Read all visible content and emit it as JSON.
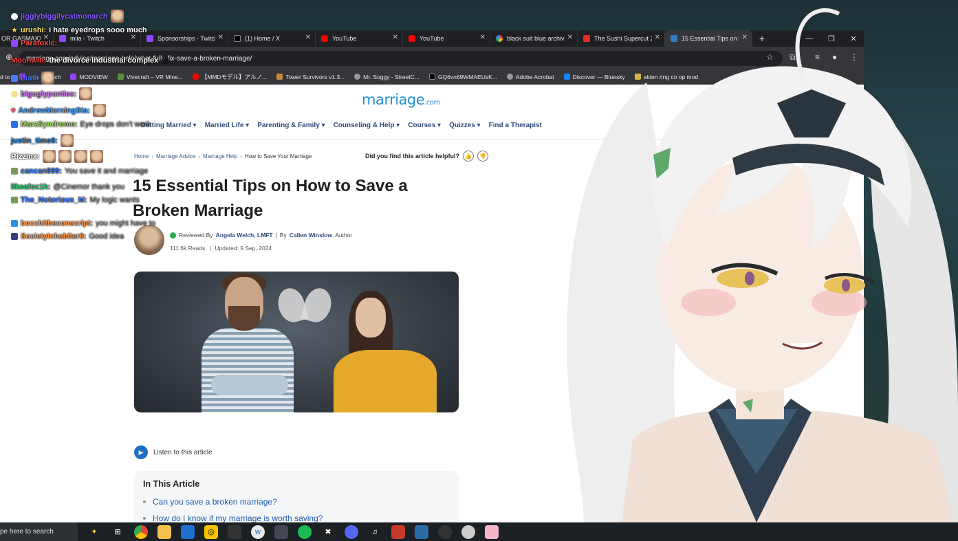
{
  "browser": {
    "tabs": [
      {
        "title": "OR GASMAXX",
        "icon": "twitch",
        "active": false
      },
      {
        "title": "miia - Twitch",
        "icon": "twitch",
        "active": false
      },
      {
        "title": "Sponsorships - Twitch",
        "icon": "twitch",
        "active": false
      },
      {
        "title": "(1) Home / X",
        "icon": "x",
        "active": false
      },
      {
        "title": "YouTube",
        "icon": "yt",
        "active": false
      },
      {
        "title": "YouTube",
        "icon": "yt",
        "active": false
      },
      {
        "title": "black suit blue archiv",
        "icon": "g",
        "active": false
      },
      {
        "title": "The Sushi Supercut 2",
        "icon": "sushi",
        "active": false
      },
      {
        "title": "15 Essential Tips on H",
        "icon": "mar",
        "active": true
      }
    ],
    "new_tab": "+",
    "address": "marriage.com/advice/marriage-help/what-fully-fix-save-a-broken-marriage/",
    "bookmarks": [
      {
        "label": "d to",
        "icon": "fav"
      },
      {
        "label": "miia - Twitch",
        "icon": "twitch"
      },
      {
        "label": "MODVIEW",
        "icon": "twitch"
      },
      {
        "label": "Vivecraft – VR Mine...",
        "icon": "fav"
      },
      {
        "label": "【MMDモデル】アルノ...",
        "icon": "yt"
      },
      {
        "label": "Tower Survivors v1.3...",
        "icon": "fav"
      },
      {
        "label": "Mr. Soggy - StreetC...",
        "icon": "fav"
      },
      {
        "label": "GQ6vn69WMAEUsK...",
        "icon": "x"
      },
      {
        "label": "Adobe Acrobat",
        "icon": "fav"
      },
      {
        "label": "Discover — Bluesky",
        "icon": "bsky"
      },
      {
        "label": "elden ring co op mod",
        "icon": "fav"
      }
    ]
  },
  "page": {
    "logo": "marriage",
    "logo_suffix": ".com",
    "nav": [
      "Getting Married ▾",
      "Married Life ▾",
      "Parenting & Family ▾",
      "Counseling & Help ▾",
      "Courses ▾",
      "Quizzes ▾",
      "Find a Therapist"
    ],
    "breadcrumbs": [
      "Home",
      "Marriage Advice",
      "Marriage Help",
      "How to Save Your Marriage"
    ],
    "breadcrumb_sep": "›",
    "helpful": "Did you find this article helpful?",
    "title": "15 Essential Tips on How to Save a Broken Marriage",
    "reviewed_by_label": "Reviewed By",
    "reviewer": "Angela Welch, LMFT",
    "by_label": "By",
    "author": "Callen Winslow",
    "author_role": ", Author",
    "reads": "111.6k Reads",
    "updated": "Updated: 9 Sep, 2024",
    "listen": "Listen to this article",
    "toc_title": "In This Article",
    "toc_items": [
      "Can you save a broken marriage?",
      "How do I know if my marriage is worth saving?"
    ]
  },
  "chat": [
    {
      "user": "jigglybiggilycatmonarch",
      "color": "#8a5cff",
      "msg": ""
    },
    {
      "user": "urushi:",
      "color": "#ffe45c",
      "msg": "i hate eyedrops sooo much"
    },
    {
      "user": "Paratoxic:",
      "color": "#ff4d4d",
      "msg": ""
    },
    {
      "user": "Moonwin:",
      "color": "#ff4040",
      "msg": "the divorce industrial complex"
    },
    {
      "user": "Luna",
      "color": "#4a7dff",
      "msg": ""
    },
    {
      "user": "biguglypanties:",
      "color": "#c878e0",
      "msg": ""
    },
    {
      "user": "AndrewMorningSta:",
      "color": "#3aa0ff",
      "msg": ""
    },
    {
      "user": "MarzSyndrome:",
      "color": "#a0e060",
      "msg": "Eye drops don't work"
    },
    {
      "user": "justin_time8:",
      "color": "#1e7fd0",
      "msg": ""
    },
    {
      "user": "Rizzmx:",
      "color": "#ffffff",
      "msg": ""
    },
    {
      "user": "cancan899:",
      "color": "#3a7dff",
      "msg": "You save it and marriage"
    },
    {
      "user": "likeafox1h:",
      "color": "#2ecc71",
      "msg": "@Cinemor thank you"
    },
    {
      "user": "The_Notorious_M:",
      "color": "#3a7dff",
      "msg": "My logic wants"
    },
    {
      "user": "bocchitheconscript:",
      "color": "#ff9a4d",
      "msg": "you might have to"
    },
    {
      "user": "SocietyInhabiter8:",
      "color": "#ff9a4d",
      "msg": "Good idea"
    }
  ],
  "taskbar": {
    "search": "pe here to search"
  }
}
